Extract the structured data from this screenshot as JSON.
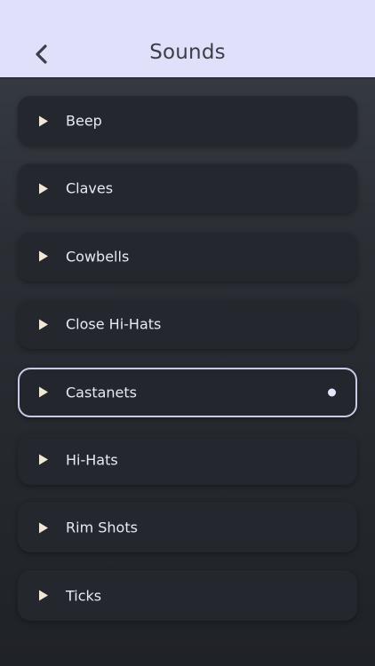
{
  "header": {
    "title": "Sounds",
    "background_color": "#e0e0fb",
    "back_icon": "chevron-left-icon"
  },
  "sounds": [
    {
      "label": "Beep",
      "selected": false
    },
    {
      "label": "Claves",
      "selected": false
    },
    {
      "label": "Cowbells",
      "selected": false
    },
    {
      "label": "Close Hi-Hats",
      "selected": false
    },
    {
      "label": "Castanets",
      "selected": true
    },
    {
      "label": "Hi-Hats",
      "selected": false
    },
    {
      "label": "Rim Shots",
      "selected": false
    },
    {
      "label": "Ticks",
      "selected": false
    }
  ],
  "icons": {
    "play": "play-icon",
    "selected_indicator": "selected-dot"
  },
  "colors": {
    "play_icon": "#f1e7d6",
    "selected_border": "#c9cbe6",
    "text": "#e9e9f2"
  }
}
